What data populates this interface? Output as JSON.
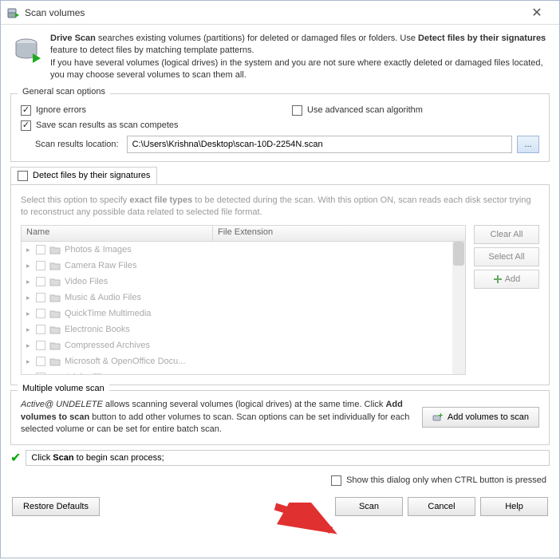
{
  "titlebar": {
    "title": "Scan volumes"
  },
  "info": {
    "strong1": "Drive Scan",
    "text1": " searches existing volumes (partitions) for deleted or damaged files or folders. Use ",
    "strong2": "Detect files by their signatures",
    "text2": " feature to detect files by matching template patterns.",
    "text3": "If you have several volumes (logical drives) in the system and you are not sure where exactly deleted or damaged files located, you may choose several volumes to scan them all."
  },
  "general": {
    "title": "General scan options",
    "ignore_errors": "Ignore errors",
    "use_advanced": "Use advanced scan algorithm",
    "save_results": "Save scan results as scan competes",
    "location_label": "Scan results location:",
    "location_value": "C:\\Users\\Krishna\\Desktop\\scan-10D-2254N.scan",
    "browse": "..."
  },
  "detect": {
    "header": "Detect files by their signatures",
    "help1": "Select this option to specify ",
    "help_strong": "exact file types",
    "help2": " to be detected during the scan. With this option ON, scan reads each disk sector trying to reconstruct any possible data related to selected file format.",
    "col_name": "Name",
    "col_ext": "File Extension",
    "rows": [
      "Photos & Images",
      "Camera Raw Files",
      "Video Files",
      "Music & Audio Files",
      "QuickTime Multimedia",
      "Electronic Books",
      "Compressed Archives",
      "Microsoft & OpenOffice Docu...",
      "Adobe Files"
    ],
    "clear_all": "Clear All",
    "select_all": "Select All",
    "add": "Add"
  },
  "multi": {
    "title": "Multiple volume scan",
    "text1": "Active@ UNDELETE",
    "text2": " allows scanning several volumes (logical drives) at the same time. Click ",
    "text3": "Add volumes to scan",
    "text4": " button to add other volumes to scan. Scan options can be set individually for each selected volume or can be set for entire batch scan.",
    "button": "Add volumes to scan"
  },
  "status": {
    "pre": "Click ",
    "strong": "Scan",
    "post": " to begin scan process;"
  },
  "show_dialog": "Show this dialog only when CTRL button is pressed",
  "buttons": {
    "restore": "Restore Defaults",
    "scan": "Scan",
    "cancel": "Cancel",
    "help": "Help"
  }
}
